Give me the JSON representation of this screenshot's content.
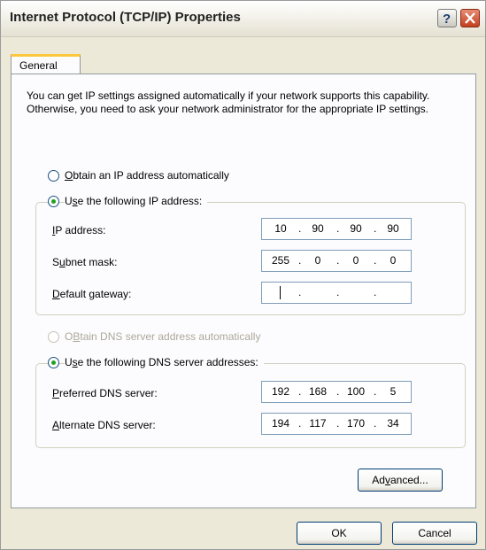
{
  "window": {
    "title": "Internet Protocol (TCP/IP) Properties"
  },
  "tabs": [
    {
      "label": "General",
      "active": true
    }
  ],
  "intro": "You can get IP settings assigned automatically if your network supports this capability. Otherwise, you need to ask your network administrator for the appropriate IP settings.",
  "ip_mode": {
    "auto_label_key": "O",
    "auto_label_rest": "btain an IP address automatically",
    "manual_label_pre": "U",
    "manual_label_key": "s",
    "manual_label_rest": "e the following IP address:",
    "selected": "manual"
  },
  "ip_fields": [
    {
      "label_key": "I",
      "label_rest": "P address:",
      "octets": [
        "10",
        "90",
        "90",
        "90"
      ]
    },
    {
      "label_pre": "S",
      "label_key": "u",
      "label_rest": "bnet mask:",
      "octets": [
        "255",
        "0",
        "0",
        "0"
      ]
    },
    {
      "label_key": "D",
      "label_rest": "efault gateway:",
      "octets": [
        "",
        "",
        "",
        ""
      ]
    }
  ],
  "dns_mode": {
    "auto_label_key": "B",
    "auto_label_pre": "O",
    "auto_label_rest": "tain DNS server address automatically",
    "manual_label_pre": "U",
    "manual_label_key": "s",
    "manual_label_rest": "e the following DNS server addresses:",
    "selected": "manual"
  },
  "dns_fields": [
    {
      "label_key": "P",
      "label_rest": "referred DNS server:",
      "octets": [
        "192",
        "168",
        "100",
        "5"
      ]
    },
    {
      "label_key": "A",
      "label_rest": "lternate DNS server:",
      "octets": [
        "194",
        "117",
        "170",
        "34"
      ]
    }
  ],
  "buttons": {
    "advanced_pre": "Ad",
    "advanced_key": "v",
    "advanced_rest": "anced...",
    "ok": "OK",
    "cancel": "Cancel"
  },
  "colors": {
    "selected_radio": "#21a121",
    "tab_highlight": "#ffc73c",
    "close_button": "#c3401f"
  }
}
